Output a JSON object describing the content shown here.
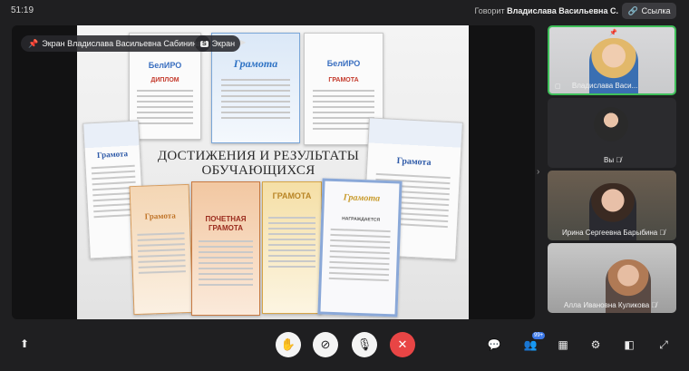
{
  "top": {
    "timer": "51:19",
    "speaking_prefix": "Говорит",
    "speaking_name": "Владислава Васильевна С.",
    "link_label": "Ссылка"
  },
  "stage": {
    "share_label": "Экран Владислава Васильевна Сабинина",
    "screen_label": "Экран",
    "screen_tag": "S"
  },
  "slide": {
    "title_line1": "ДОСТИЖЕНИЯ И РЕЗУЛЬТАТЫ",
    "title_line2": "ОБУЧАЮЩИХСЯ",
    "certs": {
      "diplom": "ДИПЛОМ",
      "gramota": "ГРАМОТА",
      "gramota_script": "Грамота",
      "pochetnaya1": "ПОЧЕТНАЯ",
      "pochetnaya2": "ГРАМОТА",
      "belipro": "БелИРО",
      "nagrazhdaetsya": "НАГРАЖДАЕТСЯ"
    }
  },
  "participants": [
    {
      "name": "Владислава Васи...",
      "active": true
    },
    {
      "name": "Вы",
      "active": false
    },
    {
      "name": "Ирина Сергеевна Барыбина",
      "active": false
    },
    {
      "name": "Алла Ивановна Куликова",
      "active": false
    }
  ],
  "toolbar": {
    "participants_badge": "99+"
  },
  "colors": {
    "active_speaker": "#3fbf5a",
    "end_call": "#e84545",
    "badge": "#3d79e8"
  }
}
